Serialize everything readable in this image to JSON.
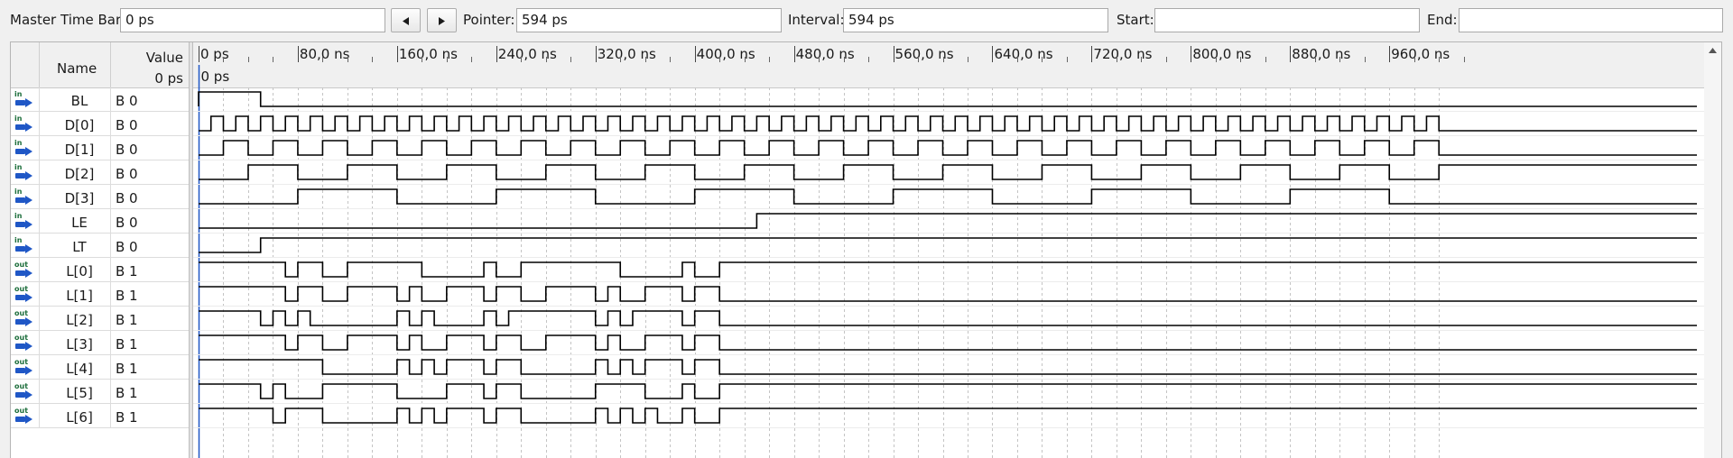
{
  "toolbar": {
    "master_label": "Master Time Bar:",
    "master_value": "0 ps",
    "pointer_label": "Pointer:",
    "pointer_value": "594 ps",
    "interval_label": "Interval:",
    "interval_value": "594 ps",
    "start_label": "Start:",
    "start_value": "",
    "end_label": "End:",
    "end_value": "",
    "prev_icon": "triangle-left-icon",
    "next_icon": "triangle-right-icon"
  },
  "header": {
    "name": "Name",
    "value": "Value",
    "value_time": "0 ps",
    "cursor_label": "0 ps"
  },
  "timeline": {
    "unit": "ns",
    "ticks": [
      "0 ps",
      "80,0 ns",
      "160,0 ns",
      "240,0 ns",
      "320,0 ns",
      "400,0 ns",
      "480,0 ns",
      "560,0 ns",
      "640,0 ns",
      "720,0 ns",
      "800,0 ns",
      "880,0 ns",
      "960,0 ns"
    ],
    "tick_values_ns": [
      0,
      80,
      160,
      240,
      320,
      400,
      480,
      560,
      640,
      720,
      800,
      880,
      960
    ],
    "visible_end_ns": 1000,
    "minor_per_major": 4,
    "cursor_ns": 0
  },
  "colors": {
    "accent": "#1f57c6",
    "wave": "#000000",
    "grid": "#b0b0b0",
    "icon": "#1f57c6",
    "icon_text": "#1b6d3a"
  },
  "signals": [
    {
      "dir": "in",
      "icon": "input-pin-icon",
      "name": "BL",
      "value": "B 0",
      "edges_ns": [
        0,
        50
      ],
      "initial": 0,
      "extends": true
    },
    {
      "dir": "in",
      "icon": "input-pin-icon",
      "name": "D[0]",
      "value": "B 0",
      "period_ns": 20,
      "initial": 0
    },
    {
      "dir": "in",
      "icon": "input-pin-icon",
      "name": "D[1]",
      "value": "B 0",
      "period_ns": 40,
      "initial": 0
    },
    {
      "dir": "in",
      "icon": "input-pin-icon",
      "name": "D[2]",
      "value": "B 0",
      "period_ns": 80,
      "initial": 0
    },
    {
      "dir": "in",
      "icon": "input-pin-icon",
      "name": "D[3]",
      "value": "B 0",
      "period_ns": 160,
      "initial": 0
    },
    {
      "dir": "in",
      "icon": "input-pin-icon",
      "name": "LE",
      "value": "B 0",
      "edges_ns": [
        450
      ],
      "initial": 0
    },
    {
      "dir": "in",
      "icon": "input-pin-icon",
      "name": "LT",
      "value": "B 0",
      "edges_ns": [
        50
      ],
      "initial": 0
    },
    {
      "dir": "out",
      "icon": "output-pin-icon",
      "name": "L[0]",
      "value": "B 1",
      "edges_ns": [
        70,
        80,
        100,
        120,
        180,
        230,
        240,
        260,
        340,
        390,
        400,
        420
      ],
      "initial": 1
    },
    {
      "dir": "out",
      "icon": "output-pin-icon",
      "name": "L[1]",
      "value": "B 1",
      "edges_ns": [
        70,
        80,
        100,
        120,
        160,
        170,
        180,
        200,
        230,
        240,
        260,
        280,
        320,
        330,
        340,
        360,
        390,
        400,
        420
      ],
      "initial": 1
    },
    {
      "dir": "out",
      "icon": "output-pin-icon",
      "name": "L[2]",
      "value": "B 1",
      "edges_ns": [
        50,
        60,
        70,
        80,
        90,
        160,
        170,
        180,
        190,
        230,
        240,
        250,
        320,
        330,
        340,
        350,
        390,
        400,
        420
      ],
      "initial": 1
    },
    {
      "dir": "out",
      "icon": "output-pin-icon",
      "name": "L[3]",
      "value": "B 1",
      "edges_ns": [
        70,
        80,
        100,
        120,
        160,
        170,
        180,
        200,
        230,
        240,
        260,
        280,
        320,
        330,
        340,
        360,
        390,
        400,
        420
      ],
      "initial": 1
    },
    {
      "dir": "out",
      "icon": "output-pin-icon",
      "name": "L[4]",
      "value": "B 1",
      "edges_ns": [
        100,
        160,
        170,
        180,
        190,
        200,
        230,
        240,
        260,
        320,
        330,
        340,
        350,
        360,
        390,
        400,
        420
      ],
      "initial": 1
    },
    {
      "dir": "out",
      "icon": "output-pin-icon",
      "name": "L[5]",
      "value": "B 1",
      "edges_ns": [
        50,
        60,
        70,
        100,
        160,
        200,
        230,
        240,
        260,
        320,
        360,
        390,
        400,
        420
      ],
      "initial": 1
    },
    {
      "dir": "out",
      "icon": "output-pin-icon",
      "name": "L[6]",
      "value": "B 1",
      "edges_ns": [
        60,
        70,
        100,
        160,
        170,
        180,
        190,
        200,
        230,
        240,
        260,
        320,
        330,
        340,
        350,
        360,
        370,
        390,
        400,
        420
      ],
      "initial": 1
    }
  ]
}
